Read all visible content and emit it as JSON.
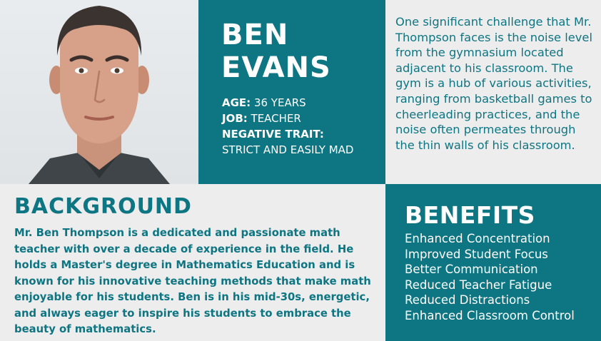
{
  "profile": {
    "name_line1": "BEN",
    "name_line2": "EVANS",
    "age_label": "AGE:",
    "age_value": "36 YEARS",
    "job_label": "JOB:",
    "job_value": "TEACHER",
    "trait_label": "NEGATIVE TRAIT:",
    "trait_value": "STRICT AND EASILY MAD"
  },
  "challenge": {
    "text": "One significant challenge that Mr. Thompson faces is the noise level from the gymnasium located adjacent to his classroom. The gym is a hub of various activities, ranging from basketball games to cheerleading practices, and the noise often permeates through the thin walls of his classroom."
  },
  "background": {
    "title": "BACKGROUND",
    "text": "Mr. Ben Thompson is a dedicated and passionate math teacher with over a decade of experience in the field. He holds a Master's degree in Mathematics Education and is known for his innovative teaching methods that make math enjoyable for his students. Ben is in his mid-30s, energetic, and always eager to inspire his students to embrace the beauty of mathematics."
  },
  "benefits": {
    "title": "BENEFITS",
    "items": [
      "Enhanced Concentration",
      "Improved Student Focus",
      "Better Communication",
      "Reduced Teacher Fatigue",
      "Reduced Distractions",
      "Enhanced Classroom Control"
    ]
  },
  "colors": {
    "teal": "#0e7582",
    "light": "#ededed"
  }
}
